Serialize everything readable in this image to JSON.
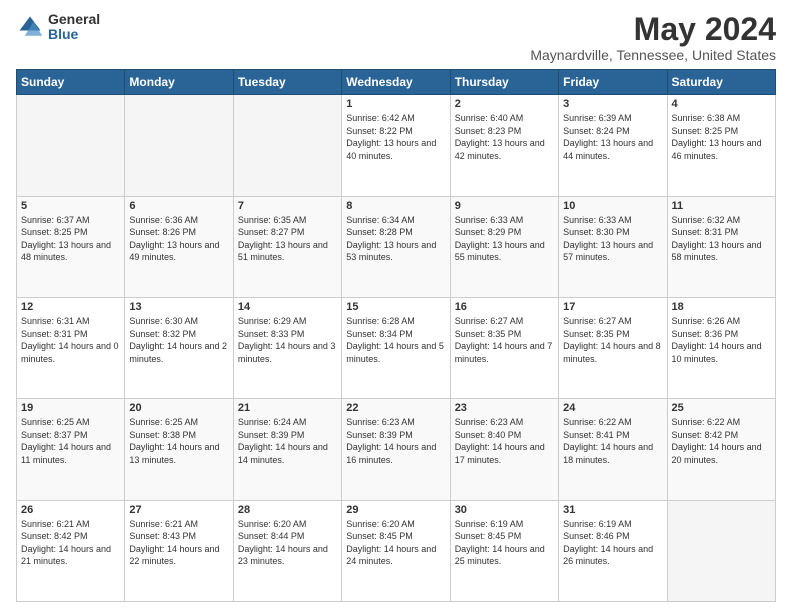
{
  "logo": {
    "general": "General",
    "blue": "Blue"
  },
  "title": "May 2024",
  "subtitle": "Maynardville, Tennessee, United States",
  "weekdays": [
    "Sunday",
    "Monday",
    "Tuesday",
    "Wednesday",
    "Thursday",
    "Friday",
    "Saturday"
  ],
  "weeks": [
    [
      {
        "day": "",
        "sunrise": "",
        "sunset": "",
        "daylight": ""
      },
      {
        "day": "",
        "sunrise": "",
        "sunset": "",
        "daylight": ""
      },
      {
        "day": "",
        "sunrise": "",
        "sunset": "",
        "daylight": ""
      },
      {
        "day": "1",
        "sunrise": "Sunrise: 6:42 AM",
        "sunset": "Sunset: 8:22 PM",
        "daylight": "Daylight: 13 hours and 40 minutes."
      },
      {
        "day": "2",
        "sunrise": "Sunrise: 6:40 AM",
        "sunset": "Sunset: 8:23 PM",
        "daylight": "Daylight: 13 hours and 42 minutes."
      },
      {
        "day": "3",
        "sunrise": "Sunrise: 6:39 AM",
        "sunset": "Sunset: 8:24 PM",
        "daylight": "Daylight: 13 hours and 44 minutes."
      },
      {
        "day": "4",
        "sunrise": "Sunrise: 6:38 AM",
        "sunset": "Sunset: 8:25 PM",
        "daylight": "Daylight: 13 hours and 46 minutes."
      }
    ],
    [
      {
        "day": "5",
        "sunrise": "Sunrise: 6:37 AM",
        "sunset": "Sunset: 8:25 PM",
        "daylight": "Daylight: 13 hours and 48 minutes."
      },
      {
        "day": "6",
        "sunrise": "Sunrise: 6:36 AM",
        "sunset": "Sunset: 8:26 PM",
        "daylight": "Daylight: 13 hours and 49 minutes."
      },
      {
        "day": "7",
        "sunrise": "Sunrise: 6:35 AM",
        "sunset": "Sunset: 8:27 PM",
        "daylight": "Daylight: 13 hours and 51 minutes."
      },
      {
        "day": "8",
        "sunrise": "Sunrise: 6:34 AM",
        "sunset": "Sunset: 8:28 PM",
        "daylight": "Daylight: 13 hours and 53 minutes."
      },
      {
        "day": "9",
        "sunrise": "Sunrise: 6:33 AM",
        "sunset": "Sunset: 8:29 PM",
        "daylight": "Daylight: 13 hours and 55 minutes."
      },
      {
        "day": "10",
        "sunrise": "Sunrise: 6:33 AM",
        "sunset": "Sunset: 8:30 PM",
        "daylight": "Daylight: 13 hours and 57 minutes."
      },
      {
        "day": "11",
        "sunrise": "Sunrise: 6:32 AM",
        "sunset": "Sunset: 8:31 PM",
        "daylight": "Daylight: 13 hours and 58 minutes."
      }
    ],
    [
      {
        "day": "12",
        "sunrise": "Sunrise: 6:31 AM",
        "sunset": "Sunset: 8:31 PM",
        "daylight": "Daylight: 14 hours and 0 minutes."
      },
      {
        "day": "13",
        "sunrise": "Sunrise: 6:30 AM",
        "sunset": "Sunset: 8:32 PM",
        "daylight": "Daylight: 14 hours and 2 minutes."
      },
      {
        "day": "14",
        "sunrise": "Sunrise: 6:29 AM",
        "sunset": "Sunset: 8:33 PM",
        "daylight": "Daylight: 14 hours and 3 minutes."
      },
      {
        "day": "15",
        "sunrise": "Sunrise: 6:28 AM",
        "sunset": "Sunset: 8:34 PM",
        "daylight": "Daylight: 14 hours and 5 minutes."
      },
      {
        "day": "16",
        "sunrise": "Sunrise: 6:27 AM",
        "sunset": "Sunset: 8:35 PM",
        "daylight": "Daylight: 14 hours and 7 minutes."
      },
      {
        "day": "17",
        "sunrise": "Sunrise: 6:27 AM",
        "sunset": "Sunset: 8:35 PM",
        "daylight": "Daylight: 14 hours and 8 minutes."
      },
      {
        "day": "18",
        "sunrise": "Sunrise: 6:26 AM",
        "sunset": "Sunset: 8:36 PM",
        "daylight": "Daylight: 14 hours and 10 minutes."
      }
    ],
    [
      {
        "day": "19",
        "sunrise": "Sunrise: 6:25 AM",
        "sunset": "Sunset: 8:37 PM",
        "daylight": "Daylight: 14 hours and 11 minutes."
      },
      {
        "day": "20",
        "sunrise": "Sunrise: 6:25 AM",
        "sunset": "Sunset: 8:38 PM",
        "daylight": "Daylight: 14 hours and 13 minutes."
      },
      {
        "day": "21",
        "sunrise": "Sunrise: 6:24 AM",
        "sunset": "Sunset: 8:39 PM",
        "daylight": "Daylight: 14 hours and 14 minutes."
      },
      {
        "day": "22",
        "sunrise": "Sunrise: 6:23 AM",
        "sunset": "Sunset: 8:39 PM",
        "daylight": "Daylight: 14 hours and 16 minutes."
      },
      {
        "day": "23",
        "sunrise": "Sunrise: 6:23 AM",
        "sunset": "Sunset: 8:40 PM",
        "daylight": "Daylight: 14 hours and 17 minutes."
      },
      {
        "day": "24",
        "sunrise": "Sunrise: 6:22 AM",
        "sunset": "Sunset: 8:41 PM",
        "daylight": "Daylight: 14 hours and 18 minutes."
      },
      {
        "day": "25",
        "sunrise": "Sunrise: 6:22 AM",
        "sunset": "Sunset: 8:42 PM",
        "daylight": "Daylight: 14 hours and 20 minutes."
      }
    ],
    [
      {
        "day": "26",
        "sunrise": "Sunrise: 6:21 AM",
        "sunset": "Sunset: 8:42 PM",
        "daylight": "Daylight: 14 hours and 21 minutes."
      },
      {
        "day": "27",
        "sunrise": "Sunrise: 6:21 AM",
        "sunset": "Sunset: 8:43 PM",
        "daylight": "Daylight: 14 hours and 22 minutes."
      },
      {
        "day": "28",
        "sunrise": "Sunrise: 6:20 AM",
        "sunset": "Sunset: 8:44 PM",
        "daylight": "Daylight: 14 hours and 23 minutes."
      },
      {
        "day": "29",
        "sunrise": "Sunrise: 6:20 AM",
        "sunset": "Sunset: 8:45 PM",
        "daylight": "Daylight: 14 hours and 24 minutes."
      },
      {
        "day": "30",
        "sunrise": "Sunrise: 6:19 AM",
        "sunset": "Sunset: 8:45 PM",
        "daylight": "Daylight: 14 hours and 25 minutes."
      },
      {
        "day": "31",
        "sunrise": "Sunrise: 6:19 AM",
        "sunset": "Sunset: 8:46 PM",
        "daylight": "Daylight: 14 hours and 26 minutes."
      },
      {
        "day": "",
        "sunrise": "",
        "sunset": "",
        "daylight": ""
      }
    ]
  ]
}
